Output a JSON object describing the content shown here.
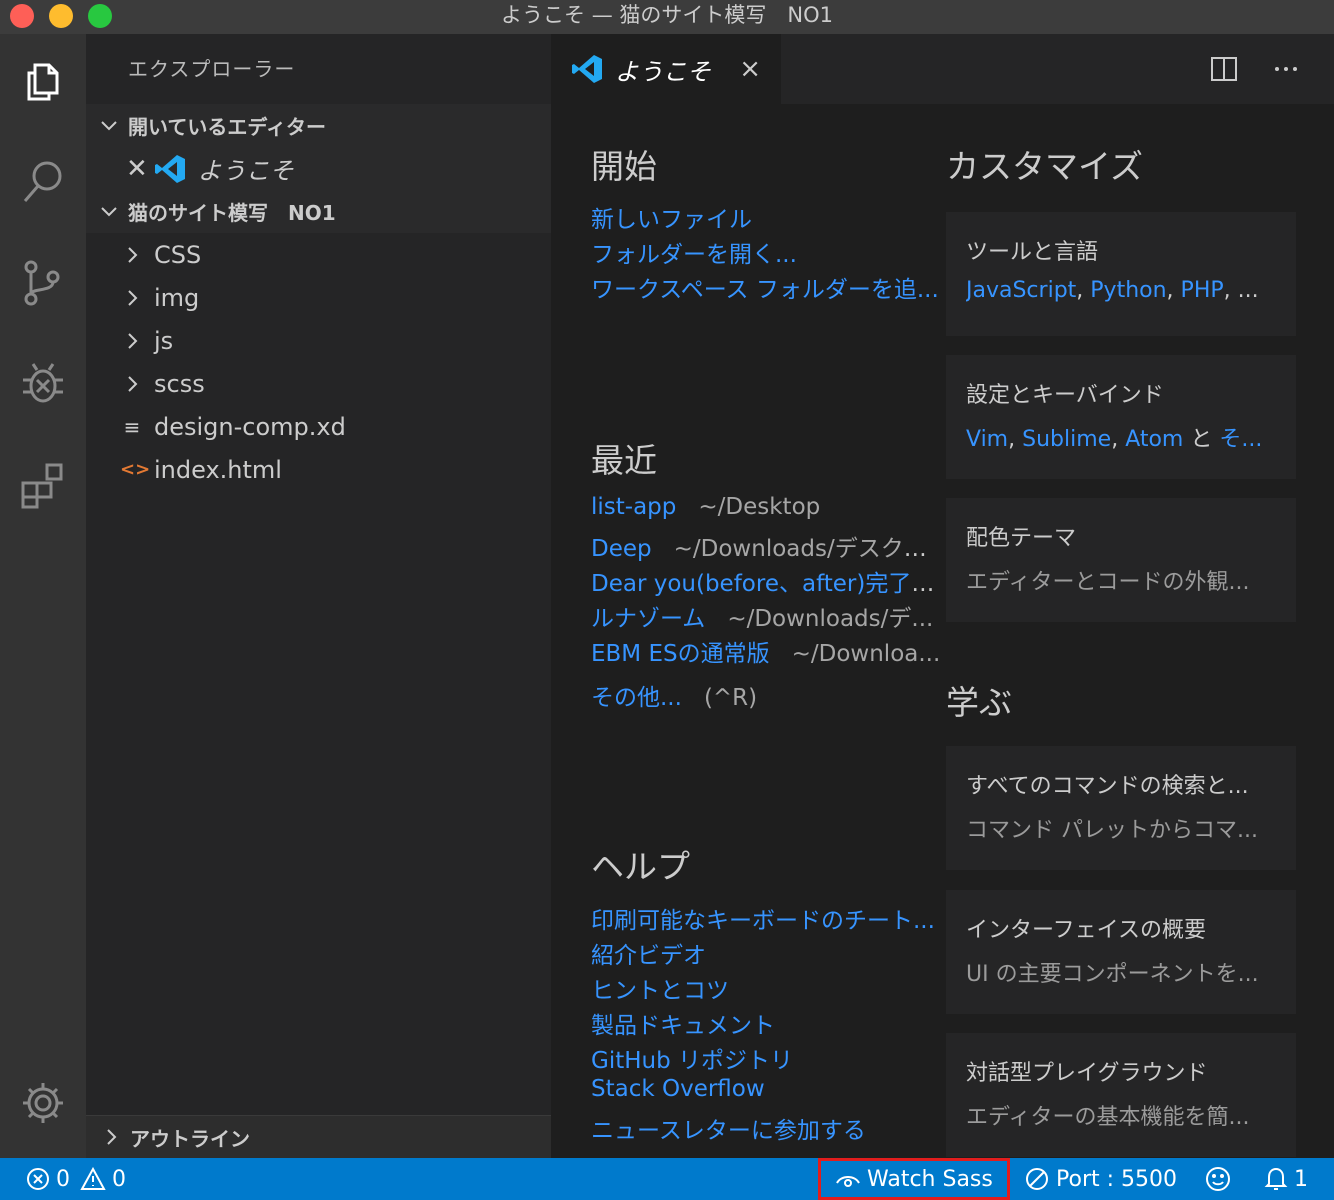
{
  "window": {
    "title": "ようこそ — 猫のサイト模写　NO1"
  },
  "activity_bar": {
    "items": [
      "explorer",
      "search",
      "source-control",
      "debug",
      "extensions"
    ],
    "bottom": "manage"
  },
  "sidebar": {
    "header": "エクスプローラー",
    "open_editors": {
      "label": "開いているエディター",
      "items": [
        {
          "label": "ようこそ"
        }
      ]
    },
    "workspace": {
      "label": "猫のサイト模写　NO1",
      "folders": [
        "CSS",
        "img",
        "js",
        "scss"
      ],
      "files": [
        {
          "name": "design-comp.xd",
          "icon": "≡"
        },
        {
          "name": "index.html",
          "icon": "<>"
        }
      ]
    },
    "outline": "アウトライン"
  },
  "tab": {
    "label": "ようこそ",
    "close": "×"
  },
  "welcome": {
    "start": {
      "heading": "開始",
      "links": [
        "新しいファイル",
        "フォルダーを開く...",
        "ワークスペース フォルダーを追..."
      ]
    },
    "recent": {
      "heading": "最近",
      "items": [
        {
          "name": "list-app",
          "path": "~/Desktop"
        },
        {
          "name": "Deep",
          "path": "~/Downloads/デスクト..."
        },
        {
          "name": "Dear you(before、after)完了",
          "path": "..."
        },
        {
          "name": "ルナゾーム",
          "path": "~/Downloads/デ..."
        },
        {
          "name": "EBM ESの通常版",
          "path": "~/Downloa..."
        }
      ],
      "more": "その他...",
      "more_shortcut": "(^R)"
    },
    "help": {
      "heading": "ヘルプ",
      "links": [
        "印刷可能なキーボードのチート...",
        "紹介ビデオ",
        "ヒントとコツ",
        "製品ドキュメント",
        "GitHub リポジトリ",
        "Stack Overflow",
        "ニュースレターに参加する"
      ]
    },
    "customize": {
      "heading": "カスタマイズ",
      "cards": [
        {
          "title": "ツールと言語",
          "links": [
            "JavaScript",
            "Python",
            "PHP"
          ],
          "tail": ", ..."
        },
        {
          "title": "設定とキーバインド",
          "links": [
            "Vim",
            "Sublime",
            "Atom"
          ],
          "tail_text": " と ",
          "tail_link": "そ..."
        },
        {
          "title": "配色テーマ",
          "sub": "エディターとコードの外観..."
        }
      ]
    },
    "learn": {
      "heading": "学ぶ",
      "cards": [
        {
          "title": "すべてのコマンドの検索と...",
          "sub": "コマンド パレットからコマ..."
        },
        {
          "title": "インターフェイスの概要",
          "sub": "UI の主要コンポーネントを..."
        },
        {
          "title": "対話型プレイグラウンド",
          "sub": "エディターの基本機能を簡..."
        }
      ]
    }
  },
  "statusbar": {
    "errors": "0",
    "warnings": "0",
    "watch_sass": "Watch Sass",
    "port": "Port : 5500",
    "notifications": "1",
    "highlight_color": "#e21d1d",
    "bg_color": "#007acc"
  }
}
